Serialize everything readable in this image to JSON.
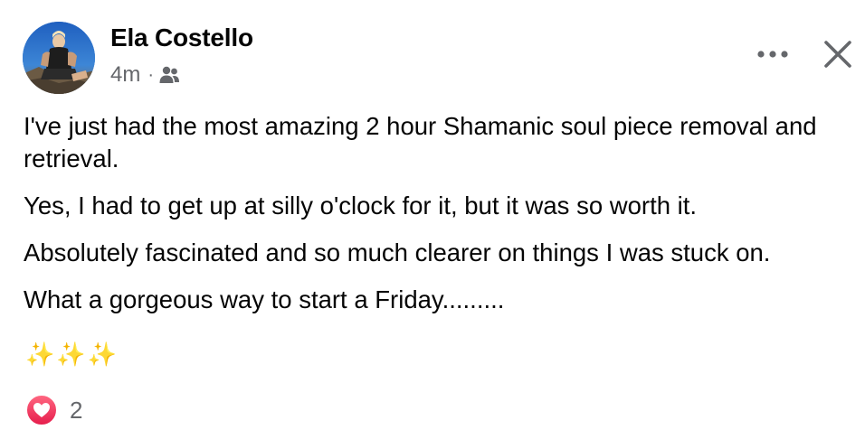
{
  "post": {
    "author": {
      "name": "Ela Costello",
      "avatar_icon": "profile-photo"
    },
    "meta": {
      "time": "4m",
      "separator": "·",
      "audience_icon": "friends-icon"
    },
    "actions": {
      "more_icon": "more-horizontal-icon",
      "close_icon": "close-icon"
    },
    "paragraphs": [
      "I've just had the most amazing 2 hour Shamanic soul piece removal and retrieval.",
      "Yes, I had to get up at silly o'clock for it, but it was so worth it.",
      "Absolutely fascinated and so much clearer on things I was stuck on.",
      "What a gorgeous way to start a Friday........."
    ],
    "sparkles": "✨✨✨",
    "reactions": {
      "icon": "heart-icon",
      "count": "2",
      "color": "#f0284a"
    }
  }
}
